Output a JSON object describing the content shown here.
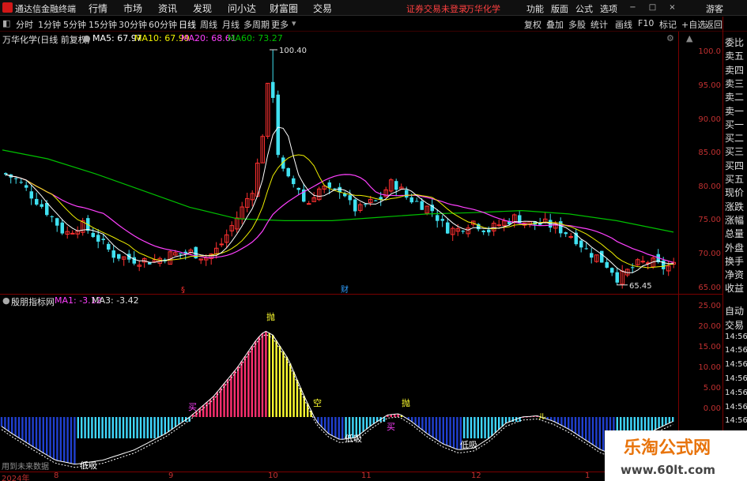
{
  "menubar": {
    "app_title": "通达信金融终端",
    "items": [
      "行情",
      "市场",
      "资讯",
      "发现",
      "问小达",
      "财富圈",
      "交易"
    ],
    "warning": "证券交易未登录",
    "stock_name": "万华化学",
    "right_items": [
      "功能",
      "版面",
      "公式",
      "选项"
    ],
    "guest": "游客",
    "window_buttons": [
      "−",
      "□",
      "×"
    ]
  },
  "periodbar": {
    "periods": [
      "分时",
      "1分钟",
      "5分钟",
      "15分钟",
      "30分钟",
      "60分钟",
      "日线",
      "周线",
      "月线",
      "多周期",
      "更多"
    ],
    "active_period": "日线",
    "right_buttons": [
      "复权",
      "叠加",
      "多股",
      "统计",
      "画线",
      "F10",
      "标记",
      "+自选",
      "返回"
    ]
  },
  "title_line": {
    "stock_label": "万华化学(日线 前复权)",
    "ma5": "MA5: 67.97",
    "ma10": "MA10: 67.99",
    "ma20": "MA20: 68.61",
    "ma60": "MA60: 73.27"
  },
  "price_axis": {
    "ticks": [
      "100.0",
      "95.00",
      "90.00",
      "85.00",
      "80.00",
      "75.00",
      "70.00",
      "65.00"
    ],
    "high_label": "100.40",
    "low_label": "65.45",
    "event_marks": [
      "§",
      "财"
    ]
  },
  "indicator": {
    "name": "殷朋指标网",
    "ma1": "MA1: -3.12",
    "ma3": "MA3: -3.42",
    "axis_ticks": [
      "25.00",
      "20.00",
      "15.00",
      "10.00",
      "5.00",
      "0.00"
    ],
    "labels": {
      "sell": "抛",
      "empty": "空",
      "buy": "买",
      "low_buy": "低吸",
      "buy_start": "买",
      "sell2": "抛",
      "low_buy2": "低吸",
      "low_buy3": "低吸",
      "hold_mark": "ル"
    }
  },
  "sidebar": {
    "items": [
      "委比",
      "卖五",
      "卖四",
      "卖三",
      "卖二",
      "卖一",
      "买一",
      "买二",
      "买三",
      "买四",
      "买五",
      "现价",
      "涨跌",
      "涨幅",
      "总量",
      "外盘",
      "换手",
      "净资",
      "收益",
      "自动",
      "交易",
      "14:56",
      "14:56",
      "14:56",
      "14:56",
      "14:56",
      "14:56",
      "14:56"
    ]
  },
  "xaxis": {
    "labels": [
      "2024年",
      "8",
      "9",
      "10",
      "11",
      "12",
      "1"
    ]
  },
  "footer": {
    "note": "用到未来数据"
  },
  "watermark": {
    "line1": "乐淘公式网",
    "line2": "www.60lt.com"
  },
  "colors": {
    "up_candle": "#ff3030",
    "down_candle": "#40e0f0",
    "ma5": "#ffffff",
    "ma10": "#f0f000",
    "ma20": "#ff40ff",
    "ma60": "#00c000",
    "bar_red": "#ff3070",
    "bar_yellow": "#ffff30",
    "bar_cyan": "#40d8ff",
    "bar_blue": "#2040d0"
  },
  "chart_data": {
    "type": "line",
    "series": [
      {
        "name": "MA5",
        "value": 67.97
      },
      {
        "name": "MA10",
        "value": 67.99
      },
      {
        "name": "MA20",
        "value": 68.61
      },
      {
        "name": "MA60",
        "value": 73.27
      }
    ],
    "price_high": 100.4,
    "price_low": 65.45,
    "ylim": [
      64,
      102
    ],
    "indicator_ylim": [
      -15,
      25
    ],
    "indicator_values": [
      -3.12,
      -3.42
    ]
  }
}
